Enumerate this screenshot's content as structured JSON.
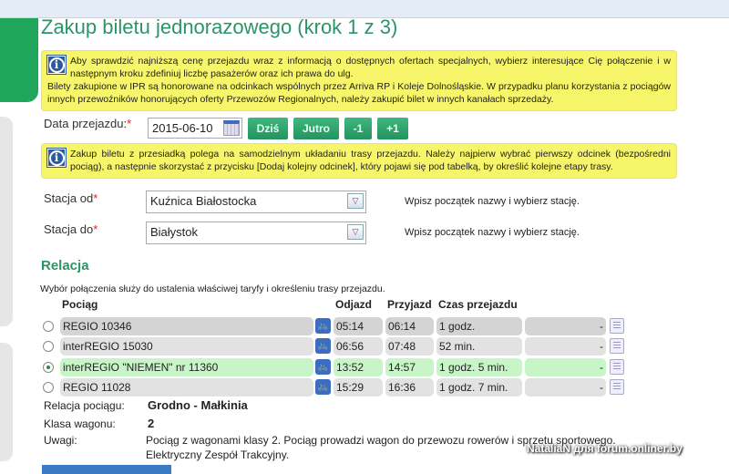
{
  "title": "Zakup biletu jednorazowego (krok 1 z 3)",
  "info1": {
    "line1": "Aby sprawdzić najniższą cenę przejazdu wraz z informacją o dostępnych ofertach specjalnych, wybierz interesujące Cię połączenie i w następnym kroku zdefiniuj liczbę pasażerów oraz ich prawa do ulg.",
    "line2": "Bilety zakupione w IPR są honorowane na odcinkach wspólnych przez Arriva RP i Koleje Dolnośląskie. W przypadku planu korzystania z pociągów innych przewoźników honorujących oferty Przewozów Regionalnych, należy zakupić bilet w innych kanałach sprzedaży."
  },
  "date": {
    "label": "Data przejazdu:",
    "required": "*",
    "value": "2015-06-10",
    "buttons": [
      "Dziś",
      "Jutro",
      "-1",
      "+1"
    ]
  },
  "info2": "Zakup biletu z przesiadką polega na samodzielnym układaniu trasy przejazdu. Należy najpierw wybrać pierwszy odcinek (bezpośredni pociąg), a następnie skorzystać z przycisku [Dodaj kolejny odcinek], który pojawi się pod tabelką, by określić kolejne etapy trasy.",
  "from": {
    "label": "Stacja od",
    "required": "*",
    "value": "Kuźnica Białostocka",
    "hint": "Wpisz początek nazwy i wybierz stację."
  },
  "to": {
    "label": "Stacja do",
    "required": "*",
    "value": "Białystok",
    "hint": "Wpisz początek nazwy i wybierz stację."
  },
  "relacja": {
    "heading": "Relacja",
    "desc": "Wybór połączenia służy do ustalenia właściwej taryfy i określeniu trasy przejazdu.",
    "headers": {
      "train": "Pociąg",
      "dep": "Odjazd",
      "arr": "Przyjazd",
      "dur": "Czas przejazdu"
    },
    "rows": [
      {
        "train": "REGIO 10346",
        "dep": "05:14",
        "arr": "06:14",
        "dur": "1 godz.",
        "extra": "-",
        "selected": false
      },
      {
        "train": "interREGIO 15030",
        "dep": "06:56",
        "arr": "07:48",
        "dur": "52 min.",
        "extra": "-",
        "selected": false
      },
      {
        "train": "interREGIO \"NIEMEN\" nr 11360",
        "dep": "13:52",
        "arr": "14:57",
        "dur": "1 godz. 5 min.",
        "extra": "-",
        "selected": true
      },
      {
        "train": "REGIO 11028",
        "dep": "15:29",
        "arr": "16:36",
        "dur": "1 godz. 7 min.",
        "extra": "-",
        "selected": false
      }
    ]
  },
  "details": {
    "route_label": "Relacja pociągu:",
    "route": "Grodno - Małkinia",
    "class_label": "Klasa wagonu:",
    "class": "2",
    "notes_label": "Uwagi:",
    "notes1": "Pociąg z wagonami klasy 2. Pociąg prowadzi wagon do przewozu rowerów i sprzetu sportowego.",
    "notes2": "Elektryczny Zespół Trakcyjny."
  },
  "watermark": "NataliaN для forum.onliner.by"
}
